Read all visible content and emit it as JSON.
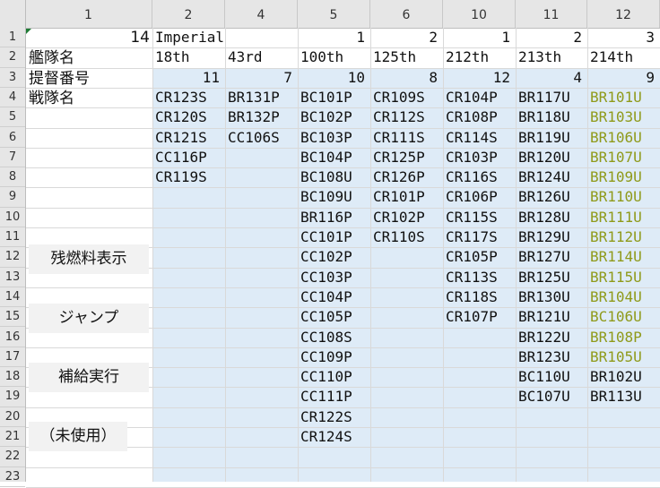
{
  "columns": [
    "1",
    "2",
    "4",
    "5",
    "6",
    "10",
    "11",
    "12"
  ],
  "rows": [
    "1",
    "2",
    "3",
    "4",
    "5",
    "6",
    "7",
    "8",
    "9",
    "10",
    "11",
    "12",
    "13",
    "14",
    "15",
    "16",
    "17",
    "18",
    "19",
    "20",
    "21",
    "22",
    "23"
  ],
  "labels": {
    "row1_value": "14",
    "row2": "艦隊名",
    "row3": "提督番号",
    "row4": "戦隊名"
  },
  "buttons": {
    "fuel": "残燃料表示",
    "jump": "ジャンプ",
    "supply": "補給実行",
    "unused": "（未使用）"
  },
  "fleets": [
    {
      "admiral": "Imperial",
      "name": "18th",
      "count": "11",
      "ships": [
        "CR123S",
        "CR120S",
        "CR121S",
        "CC116P",
        "CR119S"
      ]
    },
    {
      "admiral": "",
      "name": "43rd",
      "count": "7",
      "ships": [
        "BR131P",
        "BR132P",
        "CC106S"
      ]
    },
    {
      "admiral": "1",
      "name": "100th",
      "count": "10",
      "ships": [
        "BC101P",
        "BC102P",
        "BC103P",
        "BC104P",
        "BC108U",
        "BC109U",
        "BR116P",
        "CC101P",
        "CC102P",
        "CC103P",
        "CC104P",
        "CC105P",
        "CC108S",
        "CC109P",
        "CC110P",
        "CC111P",
        "CR122S",
        "CR124S"
      ]
    },
    {
      "admiral": "2",
      "name": "125th",
      "count": "8",
      "ships": [
        "CR109S",
        "CR112S",
        "CR111S",
        "CR125P",
        "CR126P",
        "CR101P",
        "CR102P",
        "CR110S"
      ]
    },
    {
      "admiral": "1",
      "name": "212th",
      "count": "12",
      "ships": [
        "CR104P",
        "CR108P",
        "CR114S",
        "CR103P",
        "CR116S",
        "CR106P",
        "CR115S",
        "CR117S",
        "CR105P",
        "CR113S",
        "CR118S",
        "CR107P"
      ]
    },
    {
      "admiral": "2",
      "name": "213th",
      "count": "4",
      "ships": [
        "BR117U",
        "BR118U",
        "BR119U",
        "BR120U",
        "BR124U",
        "BR126U",
        "BR128U",
        "BR129U",
        "BR127U",
        "BR125U",
        "BR130U",
        "BR121U",
        "BR122U",
        "BR123U",
        "BC110U",
        "BC107U"
      ]
    },
    {
      "admiral": "3",
      "name": "214th",
      "count": "9",
      "ships": [
        "BR101U",
        "BR103U",
        "BR106U",
        "BR107U",
        "BR109U",
        "BR110U",
        "BR111U",
        "BR112U",
        "BR114U",
        "BR115U",
        "BR104U",
        "BC106U",
        "BR108P",
        "BR105U",
        "BR102U",
        "BR113U"
      ]
    }
  ],
  "highlight_count": 14,
  "colors": {
    "highlight_text": "#8f9a1a",
    "fill": "#deebf7",
    "header": "#e6e6e6"
  }
}
